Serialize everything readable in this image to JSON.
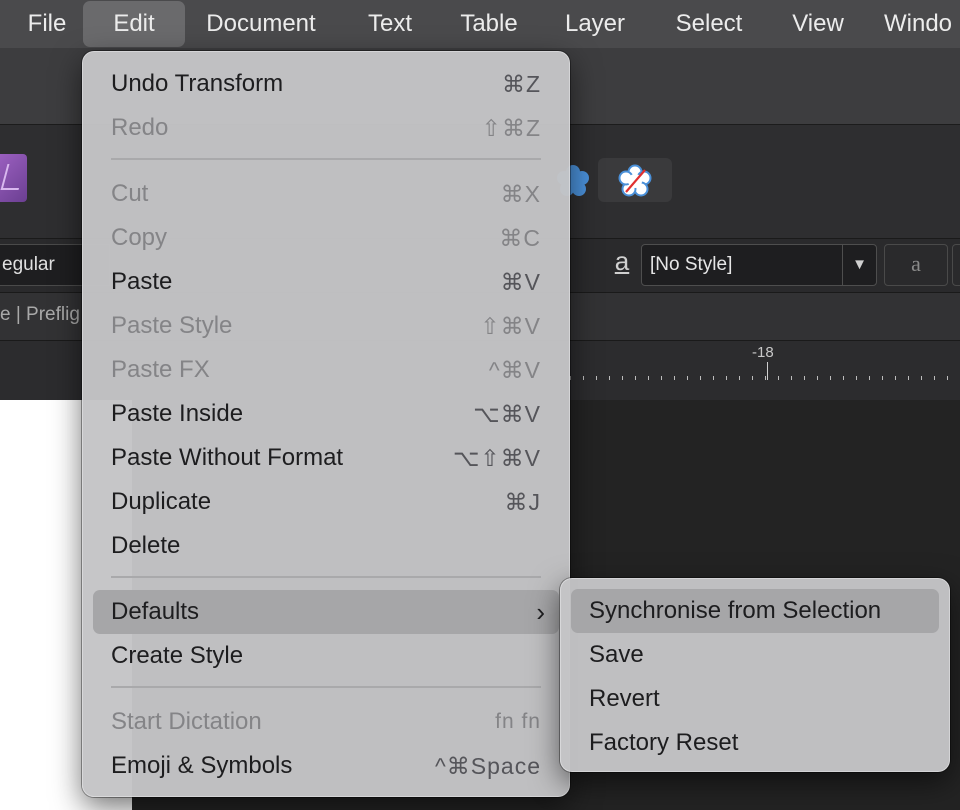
{
  "menubar": {
    "items": [
      {
        "label": "File"
      },
      {
        "label": "Edit"
      },
      {
        "label": "Document"
      },
      {
        "label": "Text"
      },
      {
        "label": "Table"
      },
      {
        "label": "Layer"
      },
      {
        "label": "Select"
      },
      {
        "label": "View"
      },
      {
        "label": "Windo"
      }
    ],
    "active_index": 1
  },
  "background": {
    "font_style_value": "egular",
    "paragraph_style_value": "[No Style]",
    "character_glyph": "a",
    "underline_glyph": "a",
    "tabs_text": "e | Preflig",
    "ruler_label": "-18"
  },
  "edit_menu": {
    "items": [
      {
        "label": "Undo Transform",
        "shortcut": "⌘Z",
        "enabled": true
      },
      {
        "label": "Redo",
        "shortcut": "⇧⌘Z",
        "enabled": false
      },
      {
        "label": "Cut",
        "shortcut": "⌘X",
        "enabled": false
      },
      {
        "label": "Copy",
        "shortcut": "⌘C",
        "enabled": false
      },
      {
        "label": "Paste",
        "shortcut": "⌘V",
        "enabled": true
      },
      {
        "label": "Paste Style",
        "shortcut": "⇧⌘V",
        "enabled": false
      },
      {
        "label": "Paste FX",
        "shortcut": "^⌘V",
        "enabled": false
      },
      {
        "label": "Paste Inside",
        "shortcut": "⌥⌘V",
        "enabled": true
      },
      {
        "label": "Paste Without Format",
        "shortcut": "⌥⇧⌘V",
        "enabled": true
      },
      {
        "label": "Duplicate",
        "shortcut": "⌘J",
        "enabled": true
      },
      {
        "label": "Delete",
        "shortcut": "",
        "enabled": true
      },
      {
        "label": "Defaults",
        "shortcut": "",
        "enabled": true,
        "submenu": true,
        "highlighted": true
      },
      {
        "label": "Create Style",
        "shortcut": "",
        "enabled": true
      },
      {
        "label": "Start Dictation",
        "shortcut": "fn fn",
        "enabled": false
      },
      {
        "label": "Emoji & Symbols",
        "shortcut": "^⌘Space",
        "enabled": true
      }
    ]
  },
  "defaults_submenu": {
    "items": [
      {
        "label": "Synchronise from Selection",
        "highlighted": true
      },
      {
        "label": "Save"
      },
      {
        "label": "Revert"
      },
      {
        "label": "Factory Reset"
      }
    ]
  },
  "colors": {
    "menubar_bg": "#4a4a4c",
    "menu_bg": "#c4c4c6",
    "highlight": "#a6a6a8",
    "disabled_text": "#848487"
  }
}
